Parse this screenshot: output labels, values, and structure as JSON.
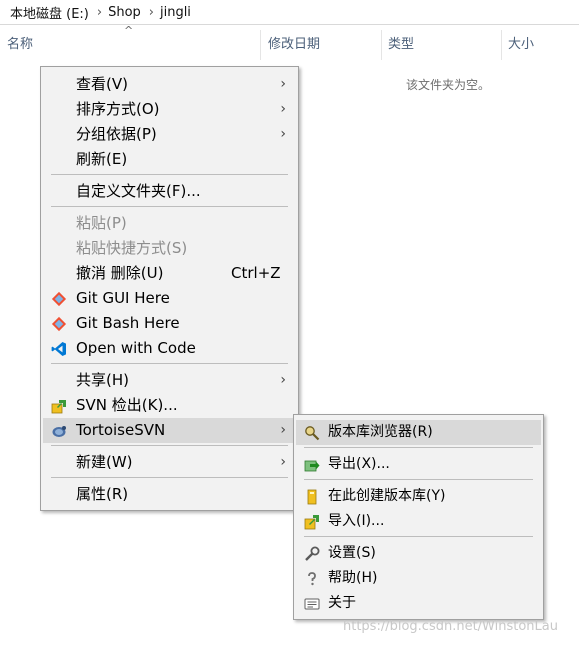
{
  "breadcrumb": {
    "items": [
      "本地磁盘 (E:)",
      "Shop",
      "jingli"
    ],
    "separator": "›"
  },
  "columns": {
    "name": "名称",
    "modified": "修改日期",
    "type": "类型",
    "size": "大小",
    "sort_indicator": "^"
  },
  "empty_message": "该文件夹为空。",
  "context_menu": {
    "view": "查看(V)",
    "sort_by": "排序方式(O)",
    "group_by": "分组依据(P)",
    "refresh": "刷新(E)",
    "customize_folder": "自定义文件夹(F)...",
    "paste": "粘贴(P)",
    "paste_shortcut": "粘贴快捷方式(S)",
    "undo_delete": "撤消 删除(U)",
    "undo_shortcut": "Ctrl+Z",
    "git_gui": "Git GUI Here",
    "git_bash": "Git Bash Here",
    "open_with_code": "Open with Code",
    "share": "共享(H)",
    "svn_checkout": "SVN 检出(K)...",
    "tortoise_svn": "TortoiseSVN",
    "new": "新建(W)",
    "properties": "属性(R)",
    "submenu_arrow": "›"
  },
  "tortoise_submenu": {
    "repo_browser": "版本库浏览器(R)",
    "export": "导出(X)...",
    "create_repo": "在此创建版本库(Y)",
    "import": "导入(I)...",
    "settings": "设置(S)",
    "help": "帮助(H)",
    "about": "关于"
  },
  "watermark": "https://blog.csdn.net/WinstonLau",
  "colors": {
    "menu_bg": "#f2f2f2",
    "menu_highlight": "#d9d9d9",
    "disabled_text": "#8d8d8d",
    "header_text": "#4c607a",
    "vscode_blue": "#0078d4",
    "git_orange": "#f05033"
  }
}
